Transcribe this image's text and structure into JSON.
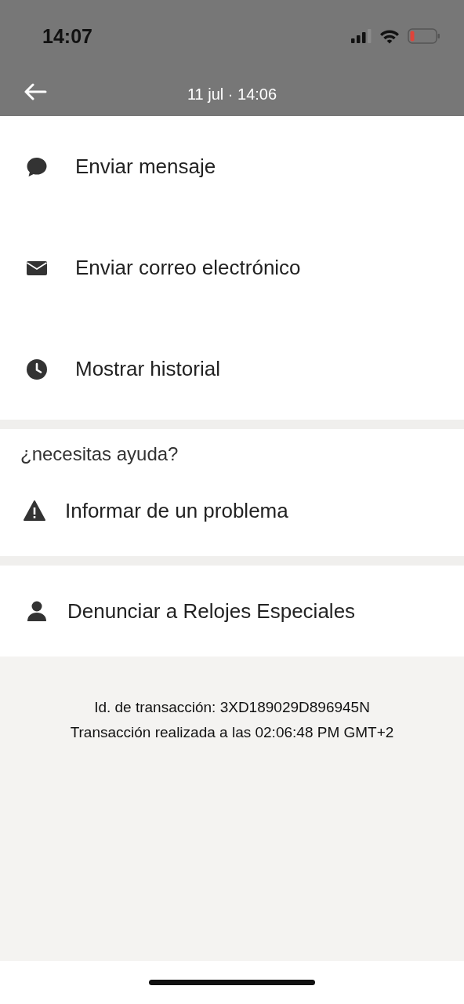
{
  "status_bar": {
    "time": "14:07"
  },
  "header": {
    "title": "11 jul · 14:06"
  },
  "actions": [
    {
      "kind": "chat",
      "label": "Enviar mensaje"
    },
    {
      "kind": "mail",
      "label": "Enviar correo electrónico"
    },
    {
      "kind": "clock",
      "label": "Mostrar historial"
    }
  ],
  "help": {
    "title": "¿necesitas ayuda?",
    "items": [
      {
        "kind": "warning",
        "label": "Informar de un problema"
      }
    ]
  },
  "report": {
    "kind": "person",
    "label": "Denunciar a Relojes Especiales"
  },
  "footer": [
    "Id. de transacción: 3XD189029D896945N",
    "Transacción realizada a las 02:06:48 PM GMT+2"
  ]
}
